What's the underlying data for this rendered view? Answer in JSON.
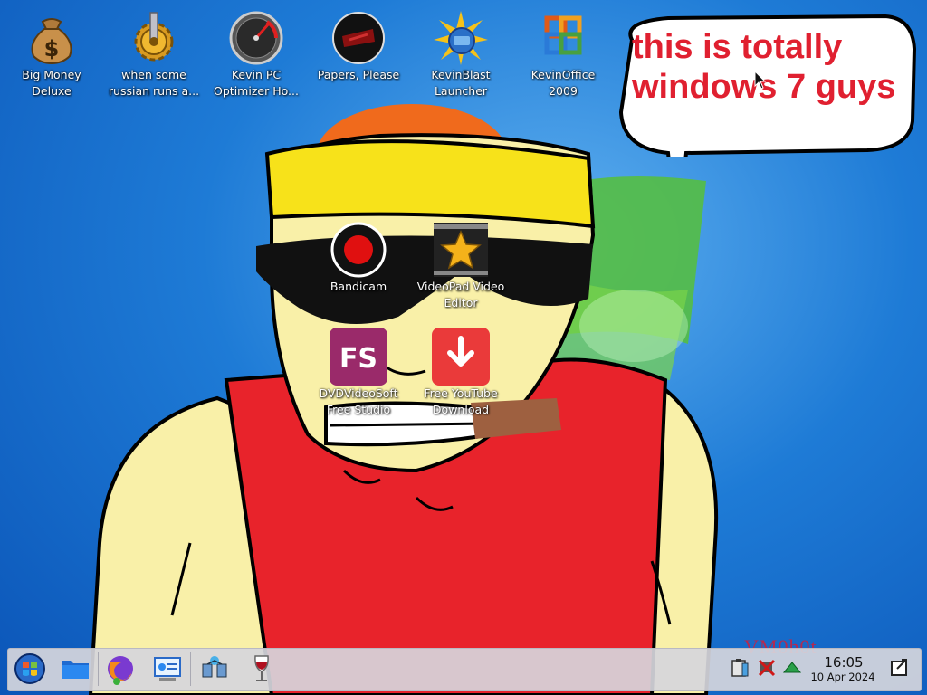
{
  "desktop_icons": [
    {
      "label": "Big Money\nDeluxe",
      "icon": "money-bag-icon"
    },
    {
      "label": "when some\nrussian runs a...",
      "icon": "gear-icon"
    },
    {
      "label": "Kevin PC\nOptimizer Ho...",
      "icon": "speedometer-icon"
    },
    {
      "label": "Papers, Please",
      "icon": "papers-please-icon"
    },
    {
      "label": "KevinBlast\nLauncher",
      "icon": "starburst-icon"
    },
    {
      "label": "KevinOffice\n2009",
      "icon": "office-icon"
    },
    {
      "label": "Bandicam",
      "icon": "record-icon"
    },
    {
      "label": "VideoPad Video\nEditor",
      "icon": "film-star-icon"
    },
    {
      "label": "DVDVideoSoft\nFree Studio",
      "icon": "fs-icon",
      "badge": "FS"
    },
    {
      "label": "Free YouTube\nDownload",
      "icon": "download-arrow-icon"
    }
  ],
  "speech_bubble": {
    "line1": "this is totally",
    "line2": "windows 7 guys"
  },
  "watermark": "VM0h0t",
  "taskbar": {
    "items": [
      "start-orb-icon",
      "file-manager-icon",
      "firefox-icon",
      "control-panel-icon",
      "network-icon",
      "wine-glass-icon"
    ],
    "tray": [
      "clipboard-icon",
      "network-disconnected-icon",
      "update-arrow-icon"
    ],
    "clock_time": "16:05",
    "clock_date": "10 Apr 2024",
    "show_desktop": "show-desktop-icon"
  },
  "colors": {
    "bubble_text": "#e02030",
    "taskbar": "#d6d6dc",
    "wallpaper": "#1e7bd6"
  }
}
